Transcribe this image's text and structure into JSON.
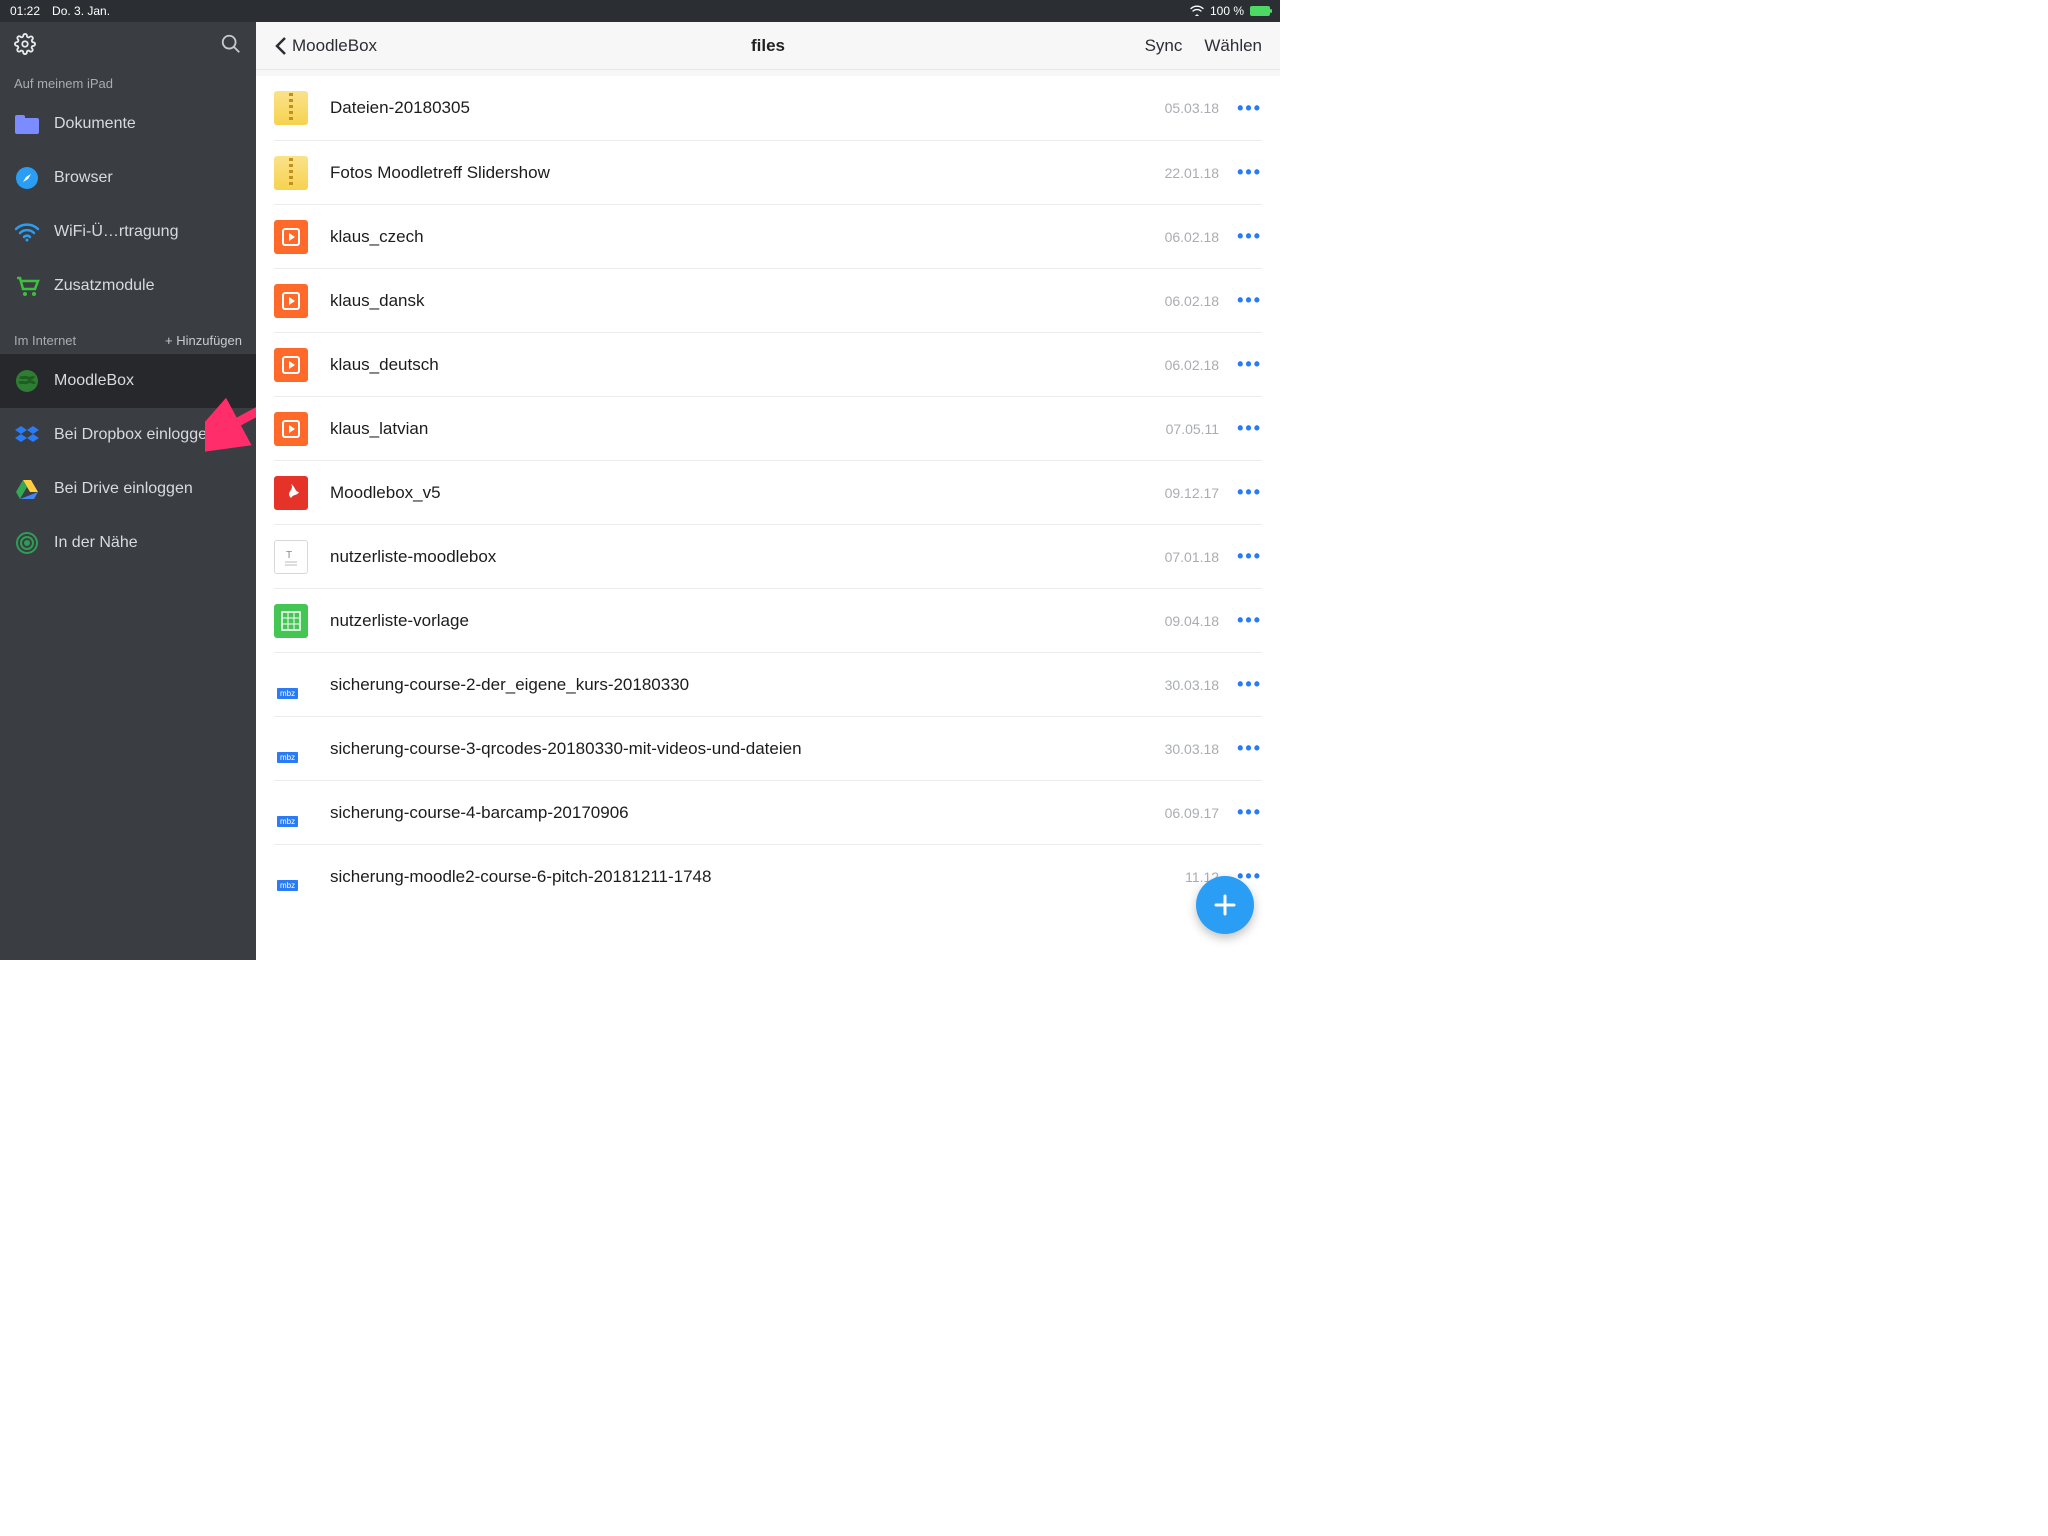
{
  "status": {
    "time": "01:22",
    "date": "Do. 3. Jan.",
    "battery_text": "100 %"
  },
  "sidebar": {
    "section_local": "Auf meinem iPad",
    "section_remote": "Im Internet",
    "add_label": "+ Hinzufügen",
    "local_items": [
      {
        "label": "Dokumente"
      },
      {
        "label": "Browser"
      },
      {
        "label": "WiFi-Ü…rtragung"
      },
      {
        "label": "Zusatzmodule"
      }
    ],
    "remote_items": [
      {
        "label": "MoodleBox"
      },
      {
        "label": "Bei Dropbox einloggen"
      },
      {
        "label": "Bei Drive einloggen"
      },
      {
        "label": "In der Nähe"
      }
    ]
  },
  "toolbar": {
    "back_label": "MoodleBox",
    "title": "files",
    "sync": "Sync",
    "select": "Wählen"
  },
  "files": [
    {
      "name": "Dateien-20180305",
      "date": "05.03.18",
      "kind": "zip"
    },
    {
      "name": "Fotos Moodletreff Slidershow",
      "date": "22.01.18",
      "kind": "zip"
    },
    {
      "name": "klaus_czech",
      "date": "06.02.18",
      "kind": "vid"
    },
    {
      "name": "klaus_dansk",
      "date": "06.02.18",
      "kind": "vid"
    },
    {
      "name": "klaus_deutsch",
      "date": "06.02.18",
      "kind": "vid"
    },
    {
      "name": "klaus_latvian",
      "date": "07.05.11",
      "kind": "vid"
    },
    {
      "name": "Moodlebox_v5",
      "date": "09.12.17",
      "kind": "pdf"
    },
    {
      "name": "nutzerliste-moodlebox",
      "date": "07.01.18",
      "kind": "rtf"
    },
    {
      "name": "nutzerliste-vorlage",
      "date": "09.04.18",
      "kind": "xls"
    },
    {
      "name": "sicherung-course-2-der_eigene_kurs-20180330",
      "date": "30.03.18",
      "kind": "mbz"
    },
    {
      "name": "sicherung-course-3-qrcodes-20180330-mit-videos-und-dateien",
      "date": "30.03.18",
      "kind": "mbz"
    },
    {
      "name": "sicherung-course-4-barcamp-20170906",
      "date": "06.09.17",
      "kind": "mbz"
    },
    {
      "name": "sicherung-moodle2-course-6-pitch-20181211-1748",
      "date": "11.12",
      "kind": "mbz"
    }
  ]
}
